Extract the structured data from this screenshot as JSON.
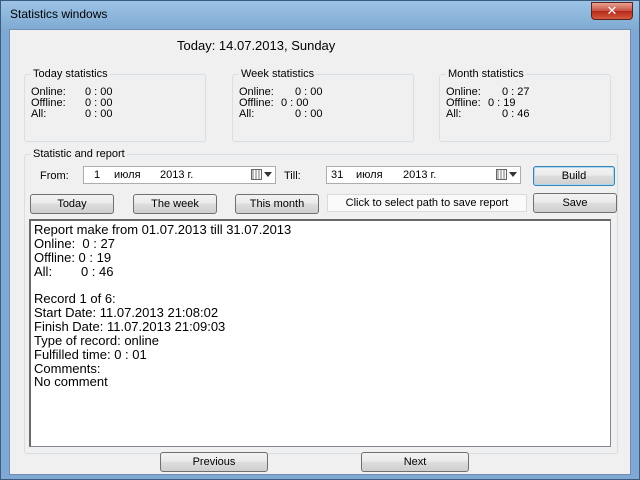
{
  "window": {
    "title": "Statistics windows",
    "close_glyph": "✕"
  },
  "header": {
    "today": "Today: 14.07.2013, Sunday"
  },
  "today_stats": {
    "title": "Today statistics",
    "rows": [
      {
        "label": "Online:",
        "value": "0 : 00"
      },
      {
        "label": "Offline:",
        "value": "0 : 00"
      },
      {
        "label": "All:",
        "value": "0 : 00"
      }
    ]
  },
  "week_stats": {
    "title": "Week statistics",
    "rows": [
      {
        "label": "Online:",
        "value": "0 : 00"
      },
      {
        "label": "Offline:",
        "value": "0 : 00"
      },
      {
        "label": "All:",
        "value": "0 : 00"
      }
    ]
  },
  "month_stats": {
    "title": "Month statistics",
    "rows": [
      {
        "label": "Online:",
        "value": "0 : 27"
      },
      {
        "label": "Offline:",
        "value": "0 : 19"
      },
      {
        "label": "All:",
        "value": "0 : 46"
      }
    ]
  },
  "report_section": {
    "title": "Statistic and report",
    "from_label": "From:",
    "from_date": {
      "day": "1",
      "month": "июля",
      "year": "2013 г."
    },
    "till_label": "Till:",
    "till_date": {
      "day": "31",
      "month": "июля",
      "year": "2013 г."
    },
    "build_label": "Build",
    "today_label": "Today",
    "week_label": "The week",
    "month_label": "This month",
    "path_label": "Click to select path to save report",
    "save_label": "Save"
  },
  "report_text": [
    "Report make from 01.07.2013 till 31.07.2013",
    "Online:  0 : 27",
    "Offline: 0 : 19",
    "All:        0 : 46",
    "",
    "Record 1 of 6:",
    "Start Date: 11.07.2013 21:08:02",
    "Finish Date: 11.07.2013 21:09:03",
    "Type of record: online",
    "Fulfilled time: 0 : 01",
    "Comments:",
    "No comment"
  ],
  "nav": {
    "previous_label": "Previous",
    "next_label": "Next"
  }
}
